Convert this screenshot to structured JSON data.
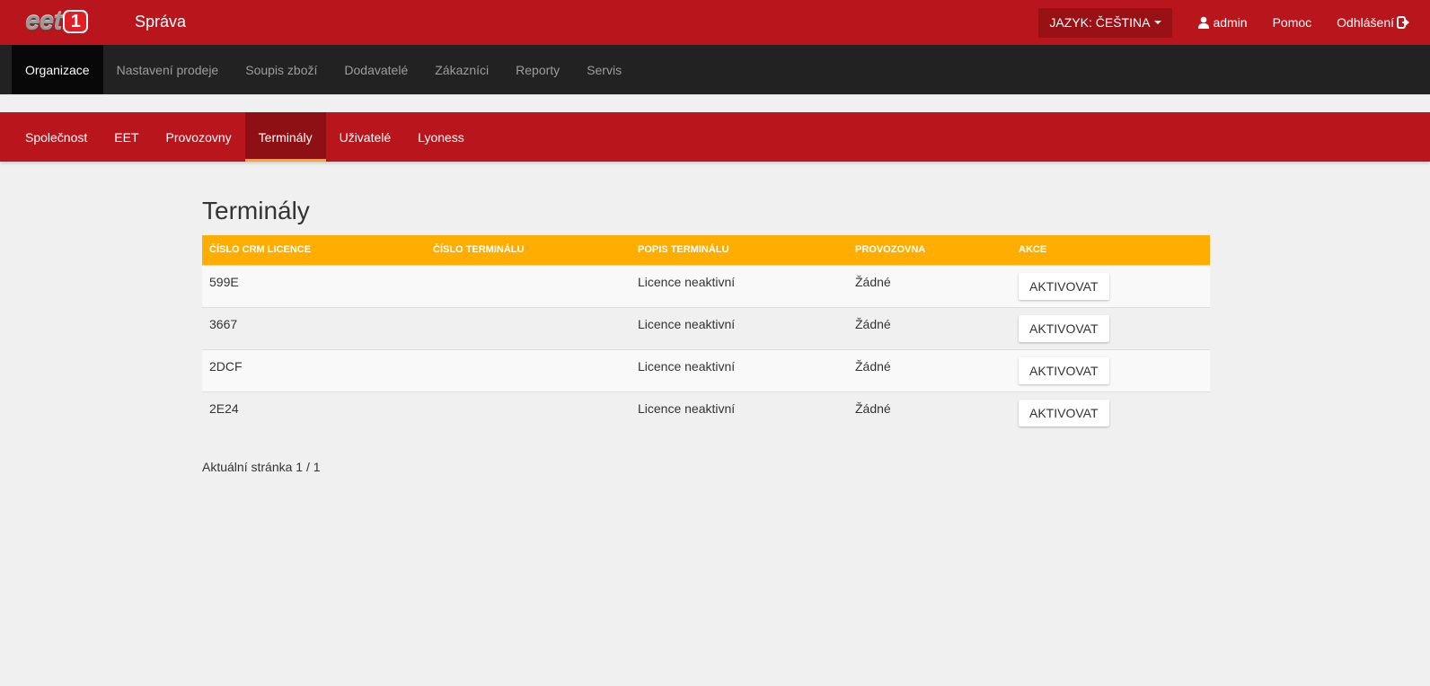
{
  "header": {
    "logo_text": "eet",
    "logo_badge": "1",
    "app_title": "Správa",
    "language_label": "JAZYK: ČEŠTINA",
    "user_label": "admin",
    "help_label": "Pomoc",
    "logout_label": "Odhlášení"
  },
  "main_nav": [
    {
      "label": "Organizace",
      "active": true
    },
    {
      "label": "Nastavení prodeje",
      "active": false
    },
    {
      "label": "Soupis zboží",
      "active": false
    },
    {
      "label": "Dodavatelé",
      "active": false
    },
    {
      "label": "Zákazníci",
      "active": false
    },
    {
      "label": "Reporty",
      "active": false
    },
    {
      "label": "Servis",
      "active": false
    }
  ],
  "sub_nav": [
    {
      "label": "Společnost",
      "active": false
    },
    {
      "label": "EET",
      "active": false
    },
    {
      "label": "Provozovny",
      "active": false
    },
    {
      "label": "Terminály",
      "active": true
    },
    {
      "label": "Uživatelé",
      "active": false
    },
    {
      "label": "Lyoness",
      "active": false
    }
  ],
  "page": {
    "title": "Terminály",
    "pager_text": "Aktuální stránka 1 / 1"
  },
  "table": {
    "columns": [
      "ČÍSLO CRM LICENCE",
      "ČÍSLO TERMINÁLU",
      "POPIS TERMINÁLU",
      "PROVOZOVNA",
      "AKCE"
    ],
    "rows": [
      {
        "licence": "599E",
        "terminal": "",
        "description": "Licence neaktivní",
        "outlet": "Žádné",
        "action": "AKTIVOVAT"
      },
      {
        "licence": "3667",
        "terminal": "",
        "description": "Licence neaktivní",
        "outlet": "Žádné",
        "action": "AKTIVOVAT"
      },
      {
        "licence": "2DCF",
        "terminal": "",
        "description": "Licence neaktivní",
        "outlet": "Žádné",
        "action": "AKTIVOVAT"
      },
      {
        "licence": "2E24",
        "terminal": "",
        "description": "Licence neaktivní",
        "outlet": "Žádné",
        "action": "AKTIVOVAT"
      }
    ]
  },
  "colors": {
    "brand_red": "#b8161c",
    "dark_nav": "#222222",
    "table_header": "#ffad00",
    "active_tab_underline": "#f9a825"
  },
  "icons": {
    "user": "user-icon",
    "logout": "logout-icon",
    "caret": "caret-down-icon"
  }
}
